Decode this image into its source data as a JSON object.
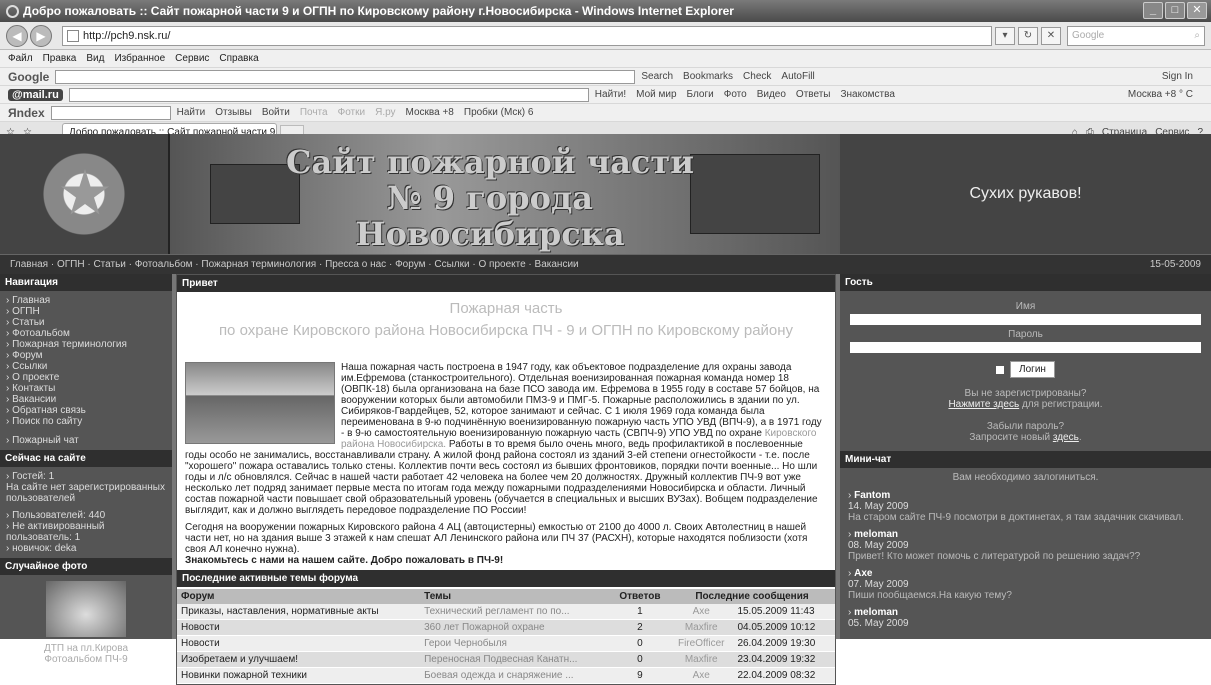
{
  "window": {
    "title": "Добро пожаловать :: Сайт пожарной части 9 и ОГПН по Кировскому району г.Новосибирска - Windows Internet Explorer"
  },
  "address": {
    "url": "http://pch9.nsk.ru/",
    "search_placeholder": "Google"
  },
  "menu": [
    "Файл",
    "Правка",
    "Вид",
    "Избранное",
    "Сервис",
    "Справка"
  ],
  "google_toolbar": {
    "logo": "Google",
    "items": [
      "Search",
      "Bookmarks",
      "Check",
      "AutoFill"
    ],
    "signin": "Sign In"
  },
  "mailru_toolbar": {
    "logo": "@mail.ru",
    "search_btn": "Найти!",
    "items": [
      "Мой мир",
      "Блоги",
      "Фото",
      "Видео",
      "Ответы",
      "Знакомства"
    ],
    "weather": "Москва +8 ° C"
  },
  "yandex_toolbar": {
    "logo": "Яndex",
    "find": "Найти",
    "items": [
      "Отзывы",
      "Войти",
      "Почта",
      "Фотки",
      "Я.ру",
      "Москва +8",
      "Пробки (Мск) 6"
    ]
  },
  "tab": {
    "label": "Добро пожаловать :: Сайт пожарной части 9 и ОГ..."
  },
  "command_bar": [
    "Страница",
    "Сервис"
  ],
  "banner": {
    "title": "Сайт пожарной части № 9 города Новосибирска www.pch9.nsk.ru",
    "slogan": "Сухих рукавов!"
  },
  "topnav": {
    "items": [
      "Главная",
      "ОГПН",
      "Статьи",
      "Фотоальбом",
      "Пожарная терминология",
      "Пресса о нас",
      "Форум",
      "Ссылки",
      "О проекте",
      "Вакансии"
    ],
    "date": "15-05-2009"
  },
  "navigation": {
    "header": "Навигация",
    "items": [
      "Главная",
      "ОГПН",
      "Статьи",
      "Фотоальбом",
      "Пожарная терминология",
      "Форум",
      "Ссылки",
      "О проекте",
      "Контакты",
      "Вакансии",
      "Обратная связь",
      "Поиск по сайту"
    ],
    "chat": "Пожарный чат"
  },
  "online": {
    "header": "Сейчас на сайте",
    "guests": "Гостей: 1",
    "no_users": "На сайте нет зарегистрированных пользователей",
    "users": "Пользователей: 440",
    "inactive": "Не активированный пользователь: 1",
    "newbie": "новичок: deka"
  },
  "random_photo": {
    "header": "Случайное фото",
    "caption": "ДТП на пл.Кирова",
    "album": "Фотоальбом ПЧ-9"
  },
  "main": {
    "header": "Привет",
    "title1": "Пожарная часть",
    "title2": "по охране Кировского района Новосибирска ПЧ - 9 и ОГПН по Кировскому району",
    "intro_a": "Наша пожарная часть построена в 1947 году, как объектовое подразделение для охраны завода им.Ефремова (станкостроительного). Отдельная военизированная пожарная команда номер 18 (ОВПК-18) была организована на базе ПСО завода им. Ефремова в 1955 году в составе 57 бойцов, на вооружении которых были автомобили ПМЗ-9 и ПМГ-5. Пожарные расположились в здании по ул. Сибиряков-Гвардейцев, 52, которое занимают и сейчас. С 1 июля 1969 года команда была переименована в 9-ю подчинённую военизированную пожарную часть УПО УВД (ВПЧ-9), а в 1971 году - в 9-ю самостоятельную военизированную пожарную часть (СВПЧ-9) УПО УВД по охране ",
    "intro_link": "Кировского района Новосибирска.",
    "intro_b": " Работы в то время было очень много, ведь профилактикой в послевоенные годы особо не занимались, восстанавливали страну. А жилой фонд района состоял из зданий 3-ей степени огнестойкости - т.е. после \"хорошего\" пожара оставались только стены. Коллектив почти весь состоял из бывших фронтовиков, порядки почти военные... Но шли годы и л/с обновлялся. Сейчас в нашей части работает 42 человека на более чем 20 должностях. Дружный коллектив ПЧ-9 вот уже несколько лет подряд занимает первые места по итогам года между пожарными подразделениями Новосибирска и области. Личный состав пожарной части повышает свой образовательный уровень (обучается в специальных и высших ВУЗах). Вобщем подразделение выглядит, как и должно выглядеть передовое подразделение ПО России!",
    "summary": "Сегодня на вооружении пожарных Кировского района 4 АЦ (автоцистерны) емкостью от 2100 до 4000 л. Своих Автолестниц в нашей части нет, но на здания выше 3 этажей к нам спешат АЛ Ленинского района или ПЧ 37 (РАСХН), которые находятся поблизости (хотя своя АЛ конечно нужна).",
    "welcome": "Знакомьтесь с нами на нашем сайте. Добро пожаловать в ПЧ-9!"
  },
  "forum": {
    "header": "Последние активные темы форума",
    "columns": [
      "Форум",
      "Темы",
      "Ответов",
      "Последние сообщения"
    ],
    "rows": [
      {
        "forum": "Приказы, наставления, нормативные акты",
        "topic": "Технический регламент по по...",
        "replies": "1",
        "author": "Axe",
        "date": "15.05.2009 11:43"
      },
      {
        "forum": "Новости",
        "topic": "360 лет Пожарной охране",
        "replies": "2",
        "author": "Maxfire",
        "date": "04.05.2009 10:12"
      },
      {
        "forum": "Новости",
        "topic": "Герои Чернобыля",
        "replies": "0",
        "author": "FireOfficer",
        "date": "26.04.2009 19:30"
      },
      {
        "forum": "Изобретаем и улучшаем!",
        "topic": "Переносная Подвесная Канатн...",
        "replies": "0",
        "author": "Maxfire",
        "date": "23.04.2009 19:32"
      },
      {
        "forum": "Новинки пожарной техники",
        "topic": "Боевая одежда и снаряжение ...",
        "replies": "9",
        "author": "Axe",
        "date": "22.04.2009 08:32"
      }
    ]
  },
  "guest": {
    "header": "Гость",
    "name_label": "Имя",
    "pass_label": "Пароль",
    "login_btn": "Логин",
    "not_registered": "Вы не зарегистрированы?",
    "register_link": "Нажмите здесь",
    "register_tail": "для регистрации.",
    "forgot": "Забыли пароль?",
    "new_pass": "Запросите новый",
    "here": "здесь"
  },
  "minichat": {
    "header": "Мини-чат",
    "notice": "Вам необходимо залогиниться.",
    "items": [
      {
        "name": "Fantom",
        "date": "14. May 2009",
        "msg": "На старом сайте ПЧ-9 посмотри в доктинетах, я там задачник скачивал."
      },
      {
        "name": "meloman",
        "date": "08. May 2009",
        "msg": "Привет! Кто может помочь с литературой по решению задач??"
      },
      {
        "name": "Axe",
        "date": "07. May 2009",
        "msg": "Пиши пообщаемся.На какую тему?"
      },
      {
        "name": "meloman",
        "date": "05. May 2009",
        "msg": ""
      }
    ]
  }
}
